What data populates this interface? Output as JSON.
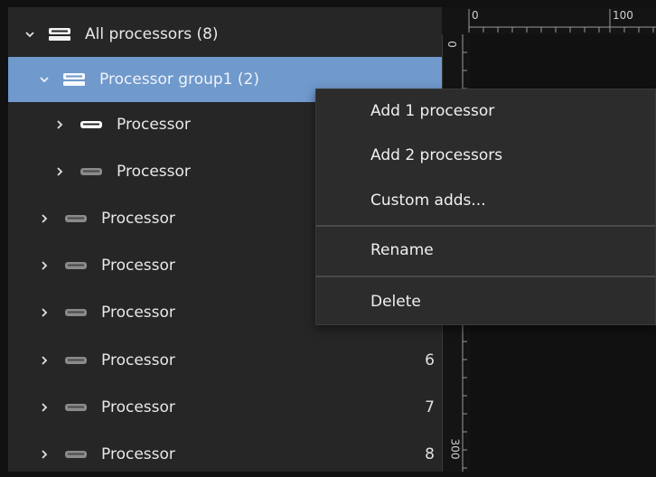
{
  "tree": {
    "root": {
      "label": "All processors (8)"
    },
    "group": {
      "label": "Processor group1 (2)"
    },
    "rows": [
      {
        "label": "Processor",
        "number": ""
      },
      {
        "label": "Processor",
        "number": ""
      },
      {
        "label": "Processor",
        "number": ""
      },
      {
        "label": "Processor",
        "number": ""
      },
      {
        "label": "Processor",
        "number": ""
      },
      {
        "label": "Processor",
        "number": "6"
      },
      {
        "label": "Processor",
        "number": "7"
      },
      {
        "label": "Processor",
        "number": "8"
      }
    ]
  },
  "ruler": {
    "h_labels": [
      "0",
      "100"
    ],
    "v_labels": [
      "0",
      "300"
    ]
  },
  "context_menu": {
    "items": [
      "Add 1 processor",
      "Add 2 processors",
      "Custom adds...",
      "Rename",
      "Delete"
    ]
  },
  "colors": {
    "selection": "#7099cc",
    "panel": "#262626",
    "menu": "#2c2c2c"
  }
}
